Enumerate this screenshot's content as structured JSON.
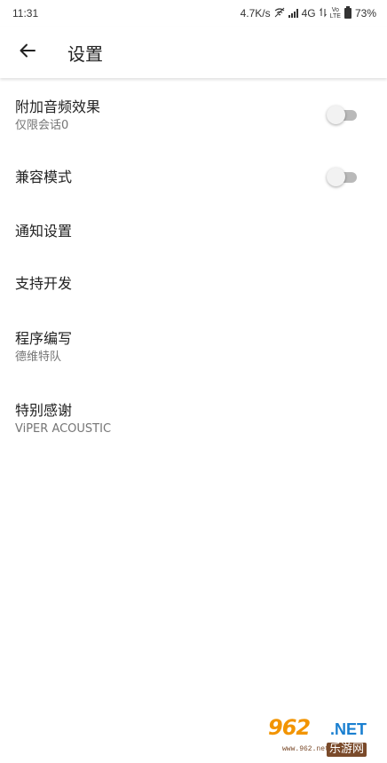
{
  "status_bar": {
    "time": "11:31",
    "network_speed": "4.7K/s",
    "network_type": "4G",
    "lte_top": "Vo",
    "lte_bottom": "LTE",
    "battery": "73%"
  },
  "app_bar": {
    "title": "设置"
  },
  "settings": {
    "items": [
      {
        "title": "附加音频效果",
        "subtitle": "仅限会话0",
        "toggle": false
      },
      {
        "title": "兼容模式",
        "toggle": false
      },
      {
        "title": "通知设置"
      },
      {
        "title": "支持开发"
      },
      {
        "title": "程序编写",
        "subtitle": "德维特队"
      },
      {
        "title": "特别感谢",
        "subtitle": "ViPER ACOUSTIC"
      }
    ]
  },
  "watermark": {
    "main": "962",
    "net": ".NET",
    "sub": "乐游网",
    "url": "www.962.net"
  },
  "colors": {
    "toggle_track_off": "#b9b9b9",
    "toggle_thumb_off": "#f2f2f2",
    "watermark_orange": "#f29400",
    "watermark_blue": "#1a7fd0"
  }
}
